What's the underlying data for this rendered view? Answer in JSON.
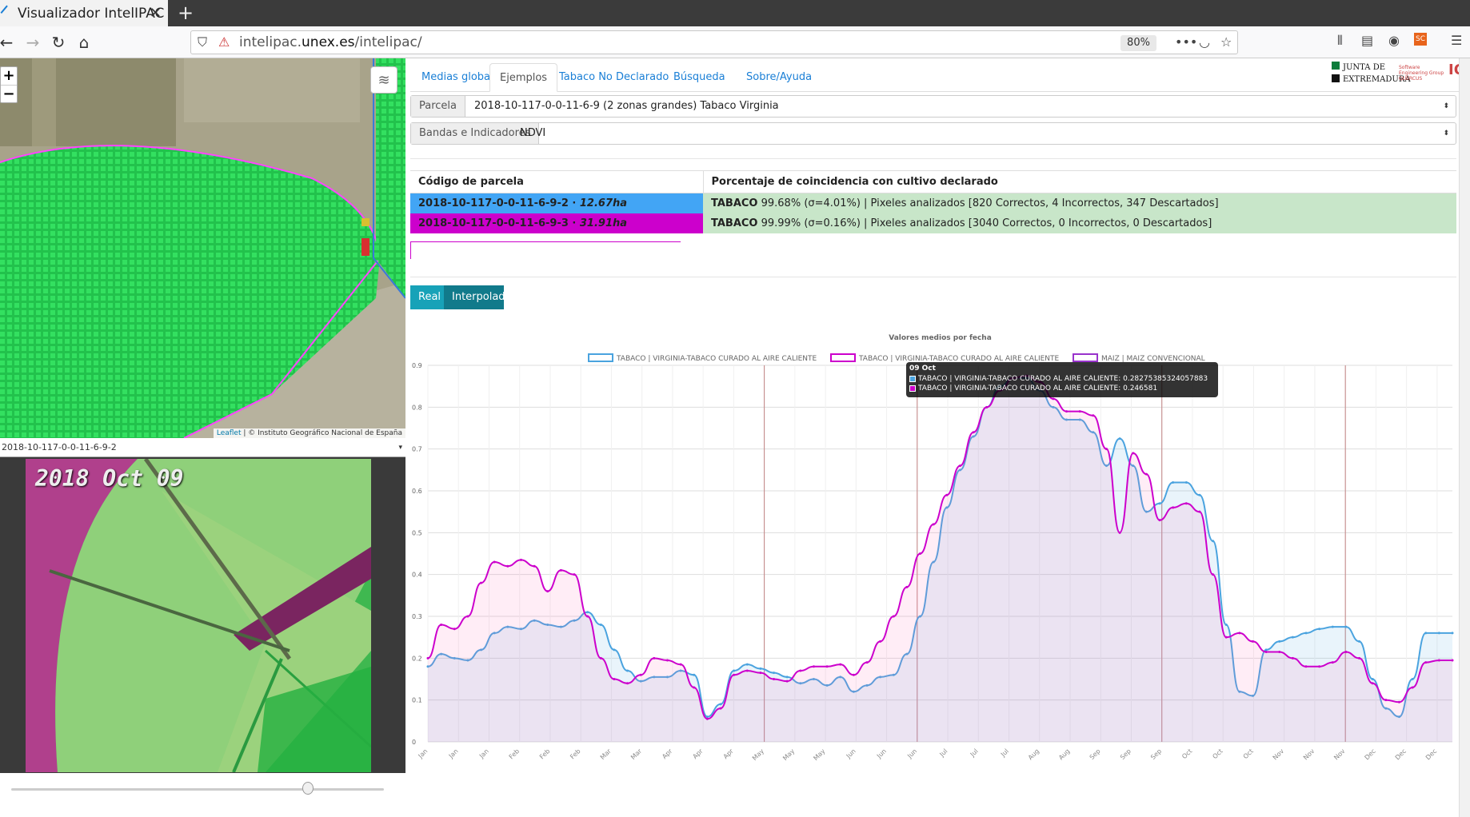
{
  "browser": {
    "tab_title": "Visualizador IntelIPAC",
    "url_prefix": "intelipac.",
    "url_domain": "unex.es",
    "url_path": "/intelipac/",
    "zoom": "80%"
  },
  "map": {
    "attribution_link": "Leaflet",
    "attribution_text": "| © Instituto Geográfico Nacional de España",
    "parcel_select": "2018-10-117-0-0-11-6-9-2"
  },
  "image_panel": {
    "date": "2018 Oct 09",
    "slider_position": 0.82
  },
  "nav": {
    "tabs": [
      "Medias globales",
      "Ejemplos",
      "Tabaco No Declarado",
      "Búsqueda",
      "Sobre/Ayuda"
    ],
    "active": 1
  },
  "logo": {
    "line1": "JUNTA DE",
    "line2": "EXTREMADURA",
    "right": "Software Engineering Group QUERCUS"
  },
  "form": {
    "parcela_label": "Parcela",
    "parcela_value": "2018-10-117-0-0-11-6-9 (2 zonas grandes) Tabaco Virginia",
    "bandas_label": "Bandas e Indicadores",
    "bandas_value": "NDVI"
  },
  "table": {
    "headers": [
      "Código de parcela",
      "Porcentaje de coincidencia con cultivo declarado"
    ],
    "rows": [
      {
        "code": "2018-10-117-0-0-11-6-9-2 · ",
        "area": "12.67ha",
        "crop": "TABACO",
        "detail": " 99.68% (σ=4.01%) | Pixeles analizados [820 Correctos, 4 Incorrectos, 347 Descartados]",
        "color": "#42a5f5"
      },
      {
        "code": "2018-10-117-0-0-11-6-9-3 · ",
        "area": "31.91ha",
        "crop": "TABACO",
        "detail": " 99.99% (σ=0.16%) | Pixeles analizados [3040 Correctos, 0 Incorrectos, 0 Descartados]",
        "color": "#cc00cc"
      }
    ]
  },
  "buttons": {
    "real": "Real",
    "interpolado": "Interpolado"
  },
  "chart_data": {
    "type": "line",
    "title": "Valores medios por fecha",
    "legend": [
      "TABACO | VIRGINIA-TABACO CURADO AL AIRE CALIENTE",
      "TABACO | VIRGINIA-TABACO CURADO AL AIRE CALIENTE",
      "MAIZ | MAIZ CONVENCIONAL"
    ],
    "legend_colors": [
      "#4aa3df",
      "#cc00cc",
      "#9933cc"
    ],
    "ylim": [
      0,
      0.9
    ],
    "yticks": [
      "0",
      "0.1",
      "0.2",
      "0.3",
      "0.4",
      "0.5",
      "0.6",
      "0.7",
      "0.8",
      "0.9"
    ],
    "xticks": [
      "Jan",
      "Jan",
      "Jan",
      "Feb",
      "Feb",
      "Feb",
      "Mar",
      "Mar",
      "Apr",
      "Apr",
      "Apr",
      "May",
      "May",
      "May",
      "Jun",
      "Jun",
      "Jun",
      "Jul",
      "Jul",
      "Jul",
      "Aug",
      "Aug",
      "Sep",
      "Sep",
      "Sep",
      "Oct",
      "Oct",
      "Oct",
      "Nov",
      "Nov",
      "Nov",
      "Dec",
      "Dec",
      "Dec"
    ],
    "vlines": [
      11,
      16,
      24,
      30
    ],
    "series": [
      {
        "name": "TABACO | VIRGINIA-TABACO CURADO AL AIRE CALIENTE",
        "color": "#4aa3df",
        "fill": "rgba(74,163,223,0.12)",
        "values": [
          0.18,
          0.21,
          0.2,
          0.195,
          0.22,
          0.26,
          0.275,
          0.27,
          0.29,
          0.28,
          0.275,
          0.29,
          0.31,
          0.28,
          0.22,
          0.17,
          0.145,
          0.155,
          0.155,
          0.17,
          0.16,
          0.06,
          0.09,
          0.17,
          0.185,
          0.175,
          0.165,
          0.155,
          0.14,
          0.15,
          0.135,
          0.155,
          0.12,
          0.135,
          0.155,
          0.16,
          0.21,
          0.3,
          0.43,
          0.56,
          0.65,
          0.73,
          0.8,
          0.85,
          0.87,
          0.87,
          0.84,
          0.8,
          0.77,
          0.77,
          0.74,
          0.66,
          0.725,
          0.66,
          0.55,
          0.57,
          0.62,
          0.62,
          0.59,
          0.48,
          0.28,
          0.12,
          0.11,
          0.22,
          0.24,
          0.25,
          0.26,
          0.27,
          0.275,
          0.275,
          0.24,
          0.15,
          0.08,
          0.06,
          0.15,
          0.26,
          0.26,
          0.26
        ]
      },
      {
        "name": "TABACO | VIRGINIA-TABACO CURADO AL AIRE CALIENTE",
        "color": "#cc00cc",
        "fill": "rgba(255,105,180,0.12)",
        "values": [
          0.2,
          0.28,
          0.27,
          0.3,
          0.38,
          0.43,
          0.42,
          0.435,
          0.42,
          0.36,
          0.41,
          0.4,
          0.3,
          0.2,
          0.15,
          0.14,
          0.16,
          0.2,
          0.195,
          0.185,
          0.13,
          0.055,
          0.08,
          0.16,
          0.17,
          0.165,
          0.15,
          0.145,
          0.17,
          0.18,
          0.18,
          0.185,
          0.16,
          0.19,
          0.24,
          0.3,
          0.37,
          0.45,
          0.52,
          0.59,
          0.66,
          0.74,
          0.8,
          0.84,
          0.87,
          0.875,
          0.86,
          0.82,
          0.79,
          0.79,
          0.78,
          0.7,
          0.5,
          0.69,
          0.64,
          0.53,
          0.56,
          0.57,
          0.55,
          0.4,
          0.25,
          0.26,
          0.24,
          0.215,
          0.215,
          0.2,
          0.18,
          0.18,
          0.19,
          0.215,
          0.2,
          0.14,
          0.1,
          0.095,
          0.13,
          0.19,
          0.195,
          0.195
        ]
      },
      {
        "name": "MAIZ | MAIZ CONVENCIONAL",
        "color": "#9933cc",
        "fill": "rgba(153,51,204,0.0)",
        "values": []
      }
    ]
  },
  "tooltip": {
    "title": "09 Oct",
    "line1": "TABACO | VIRGINIA-TABACO CURADO AL AIRE CALIENTE: 0.28275385324057883",
    "line2": "TABACO | VIRGINIA-TABACO CURADO AL AIRE CALIENTE: 0.246581",
    "color1": "#4aa3df",
    "color2": "#cc00cc"
  }
}
